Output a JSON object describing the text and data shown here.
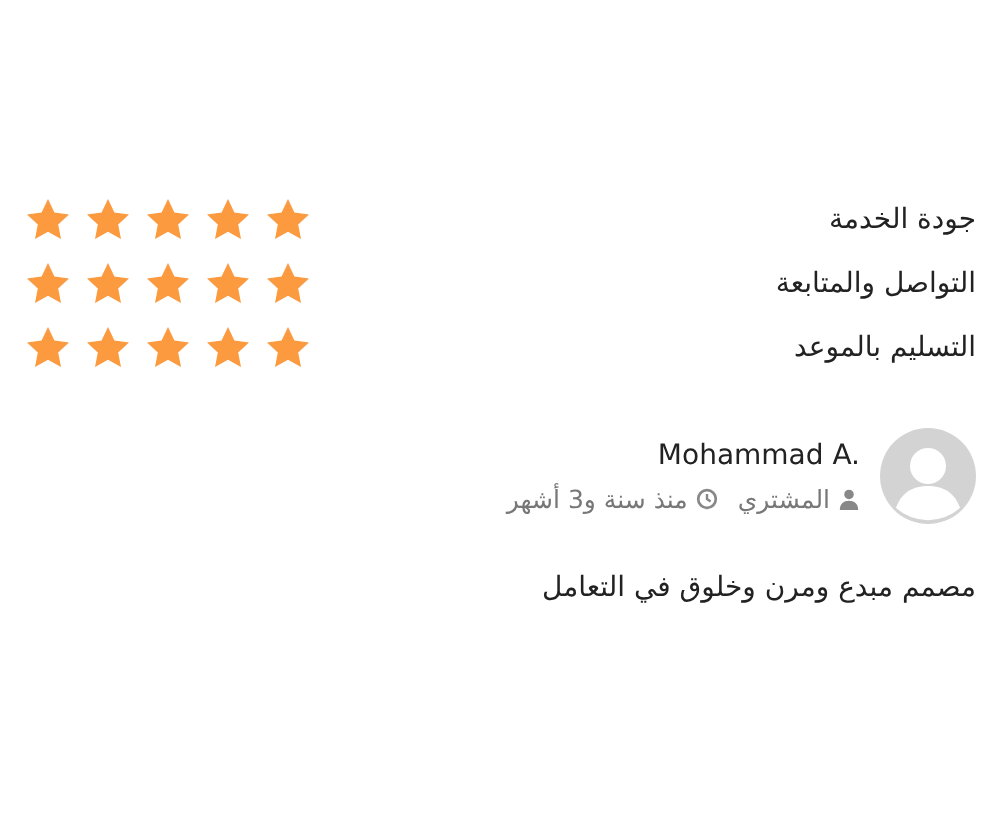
{
  "ratings": [
    {
      "label": "جودة الخدمة",
      "stars": 5
    },
    {
      "label": "التواصل والمتابعة",
      "stars": 5
    },
    {
      "label": "التسليم بالموعد",
      "stars": 5
    }
  ],
  "review": {
    "name": "Mohammad A.",
    "role": "المشتري",
    "time": "منذ سنة و3 أشهر",
    "comment": "مصمم مبدع ومرن وخلوق في التعامل"
  }
}
